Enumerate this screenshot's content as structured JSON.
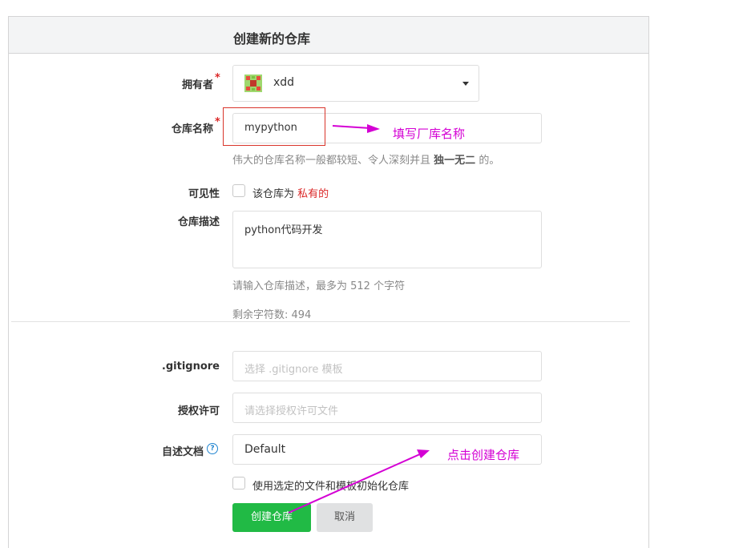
{
  "header": {
    "title": "创建新的仓库"
  },
  "form": {
    "owner": {
      "label": "拥有者",
      "required_mark": "*",
      "value": "xdd",
      "avatar_icon": "identicon-avatar"
    },
    "repo_name": {
      "label": "仓库名称",
      "required_mark": "*",
      "value": "mypython",
      "hint_prefix": "伟大的仓库名称一般都较短、令人深刻并且",
      "hint_bold": "独一无二",
      "hint_suffix": "的。"
    },
    "visibility": {
      "label": "可见性",
      "checkbox_text": "该仓库为",
      "private_text": "私有的",
      "checked": false
    },
    "description": {
      "label": "仓库描述",
      "value": "python代码开发",
      "hint": "请输入仓库描述，最多为 512 个字符",
      "remaining": "剩余字符数: 494"
    },
    "gitignore": {
      "label": ".gitignore",
      "placeholder": "选择 .gitignore 模板"
    },
    "license": {
      "label": "授权许可",
      "placeholder": "请选择授权许可文件"
    },
    "readme": {
      "label": "自述文档",
      "value": "Default",
      "help_icon": "question-circle-icon",
      "help_glyph": "?"
    },
    "auto_init": {
      "text": "使用选定的文件和模板初始化仓库",
      "checked": false
    },
    "buttons": {
      "create": "创建仓库",
      "cancel": "取消"
    }
  },
  "annotations": {
    "name_note": "填写厂库名称",
    "create_note": "点击创建仓库"
  },
  "colors": {
    "accent_green": "#21ba45",
    "annotation_magenta": "#d400d4",
    "required_red": "#db2828"
  }
}
